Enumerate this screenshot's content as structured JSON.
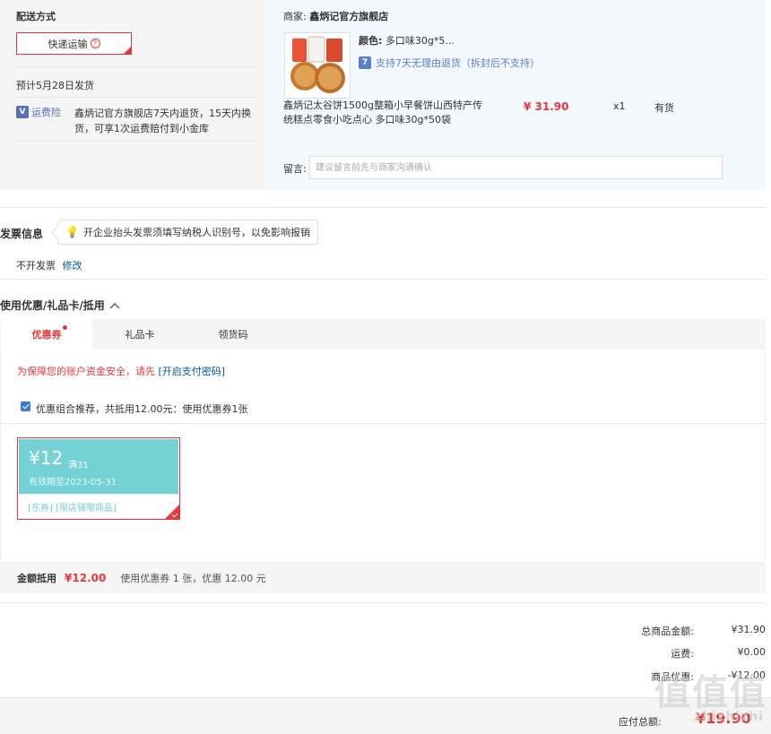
{
  "delivery": {
    "header": "配送方式",
    "method": "快递运输",
    "help_icon": "?",
    "estimated": "预计5月28日发货",
    "insurance_label": "运费险",
    "insurance_desc_1": "鑫炳记官方旗舰店7天内退货，15天内换",
    "insurance_desc_2": "货，可享1次运费赔付到小金库"
  },
  "shop": {
    "seller_prefix": "商家:",
    "seller_name": "鑫炳记官方旗舰店",
    "color_label": "颜色:",
    "color_value": "多口味30g*5...",
    "return_policy": "支持7天无理由退货（拆封后不支持）",
    "return_icon": "7",
    "product_title_1": "鑫炳记太谷饼1500g整箱小早餐饼山西特产传",
    "product_title_2": "统糕点零食小吃点心 多口味30g*50袋",
    "price": "¥ 31.90",
    "quantity": "x1",
    "stock": "有货",
    "message_label": "留言:",
    "message_placeholder": "建议留言前先与商家沟通确认"
  },
  "invoice": {
    "header": "发票信息",
    "tip": "开企业抬头发票须填写纳税人识别号，以免影响报销",
    "status": "不开发票",
    "modify": "修改"
  },
  "discount": {
    "header": "使用优惠/礼品卡/抵用",
    "tabs": [
      {
        "label": "优惠券"
      },
      {
        "label": "礼品卡"
      },
      {
        "label": "领货码"
      }
    ],
    "security_text": "为保障您的账户资金安全，请先",
    "security_link": "[开启支付密码]",
    "combo_text": "优惠组合推荐，共抵用12.00元：使用优惠券1张",
    "coupon": {
      "amount": "¥12",
      "condition": "满31",
      "valid": "有效期至2023-05-31",
      "tags": "[东券]  [限店铺限商品]"
    },
    "deduct_label": "金额抵用",
    "deduct_value": "¥12.00",
    "deduct_desc": "使用优惠券 1 张，优惠 12.00 元"
  },
  "summary": {
    "total_label": "总商品金额:",
    "total_value": "¥31.90",
    "shipping_label": "运费:",
    "shipping_value": "¥0.00",
    "promo_label": "商品优惠:",
    "promo_value": "-¥12.00",
    "payable_label": "应付总额:",
    "payable_value": "¥19.90"
  },
  "watermark": {
    "text": "值值值",
    "sub": "zhizhizhi"
  }
}
